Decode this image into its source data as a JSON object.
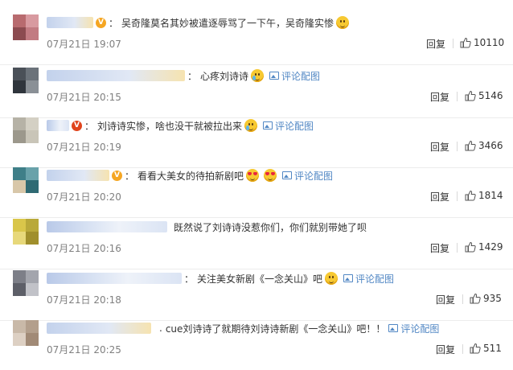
{
  "comments": [
    {
      "avatar": [
        "#b86b6f",
        "#d89aa0",
        "#8c4b50",
        "#c27b82"
      ],
      "badge": {
        "type": "orange",
        "glyph": "V"
      },
      "text": "吴奇隆莫名其妙被遣逐辱骂了一下午，吴奇隆实惨",
      "emoji": "smile",
      "pic_label": "",
      "time": "07月21日 19:07",
      "reply_label": "回复",
      "likes": "10110"
    },
    {
      "avatar": [
        "#4a5058",
        "#6b727a",
        "#2f353c",
        "#8a9096"
      ],
      "badge": {
        "type": "none",
        "glyph": ""
      },
      "text": "心疼刘诗诗",
      "emoji": "tear",
      "pic_label": "评论配图",
      "time": "07月21日 20:15",
      "reply_label": "回复",
      "likes": "5146"
    },
    {
      "avatar": [
        "#b6b2a6",
        "#d4d0c4",
        "#9c988c",
        "#c9c5b8"
      ],
      "badge": {
        "type": "red",
        "glyph": "V"
      },
      "text": "刘诗诗实惨，啥也没干就被拉出来",
      "emoji": "tear",
      "pic_label": "评论配图",
      "time": "07月21日 20:19",
      "reply_label": "回复",
      "likes": "3466"
    },
    {
      "avatar": [
        "#3f7f88",
        "#69a2aa",
        "#d8c7a9",
        "#2f6a73"
      ],
      "badge": {
        "type": "orange",
        "glyph": "V"
      },
      "text": "看看大美女的待拍新剧吧",
      "emoji": "heart2",
      "pic_label": "评论配图",
      "time": "07月21日 20:20",
      "reply_label": "回复",
      "likes": "1814"
    },
    {
      "avatar": [
        "#d9c64a",
        "#b9a93a",
        "#e7d87a",
        "#a08f2c"
      ],
      "badge": {
        "type": "none",
        "glyph": ""
      },
      "text": "既然说了刘诗诗没惹你们，你们就别带她了呗",
      "emoji": "",
      "pic_label": "",
      "time": "07月21日 20:16",
      "reply_label": "回复",
      "likes": "1429"
    },
    {
      "avatar": [
        "#7d7f88",
        "#a3a5ad",
        "#5d5f68",
        "#c1c2c8"
      ],
      "badge": {
        "type": "none",
        "glyph": ""
      },
      "text": "关注美女新剧《一念关山》吧",
      "emoji": "smile",
      "pic_label": "评论配图",
      "time": "07月21日 20:18",
      "reply_label": "回复",
      "likes": "935"
    },
    {
      "avatar": [
        "#c9b9a8",
        "#b39f8c",
        "#ddd0c3",
        "#a18a76"
      ],
      "badge": {
        "type": "none",
        "glyph": ""
      },
      "text": "cue刘诗诗了就期待刘诗诗新剧《一念关山》吧！！",
      "emoji": "",
      "pic_label": "评论配图",
      "time": "07月21日 20:25",
      "reply_label": "回复",
      "likes": "511"
    }
  ]
}
